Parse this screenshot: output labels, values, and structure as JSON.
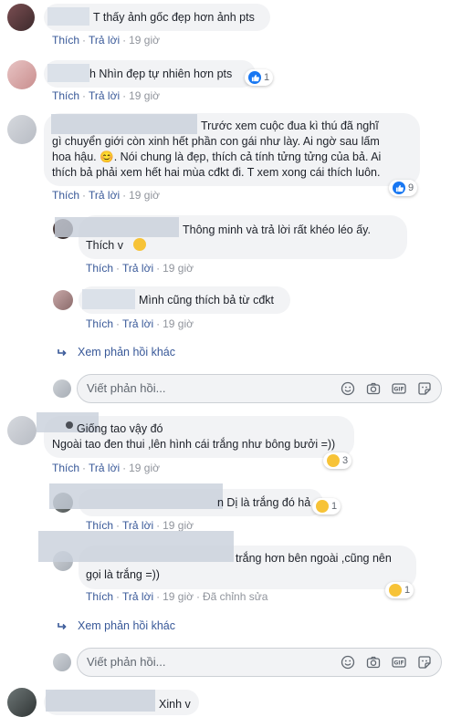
{
  "labels": {
    "like": "Thích",
    "reply": "Trả lời",
    "see_more_replies": "Xem phản hồi khác",
    "write_reply_placeholder": "Viết phản hồi...",
    "edited": "Đã chỉnh sửa"
  },
  "comments": [
    {
      "text": "T thấy ảnh gốc đẹp hơn ảnh pts",
      "time": "19 giờ"
    },
    {
      "text": "h Nhìn đẹp tự nhiên hơn pts",
      "time": "19 giờ",
      "reactions": "1"
    },
    {
      "text_lines": [
        "Trước xem cuộc đua kì thú đã nghĩ",
        "gì chuyển giới còn xinh hết phần con gái như lày. Ai ngờ sau lấm",
        "hoa hậu. 😊. Nói chung là đẹp, thích cả tính tửng tửng của bả. Ai",
        "thích bả phải xem hết hai mùa cđkt đi. T xem xong cái thích luôn."
      ],
      "time": "19 giờ",
      "reactions": "9"
    },
    {
      "text_lines": [
        "Thông minh và trả lời rất khéo léo ấy.",
        "Thích v"
      ],
      "time": "19 giờ"
    },
    {
      "text": "Mình cũng thích bả từ cđkt",
      "time": "19 giờ"
    },
    {
      "text_lines": [
        "Giống tao vậy đó",
        "Ngoài tao đen thui ,lên hình cái trắng như bông bưởi =))"
      ],
      "time": "19 giờ",
      "reactions": "3"
    },
    {
      "text": "n Dị là trắng đó hả",
      "time": "19 giờ",
      "reactions": "1"
    },
    {
      "text_lines": [
        "trắng hơn bên ngoài ,cũng nên",
        "gọi là trắng =))"
      ],
      "time": "19 giờ",
      "reactions": "1"
    },
    {
      "text": "Xinh v"
    }
  ]
}
